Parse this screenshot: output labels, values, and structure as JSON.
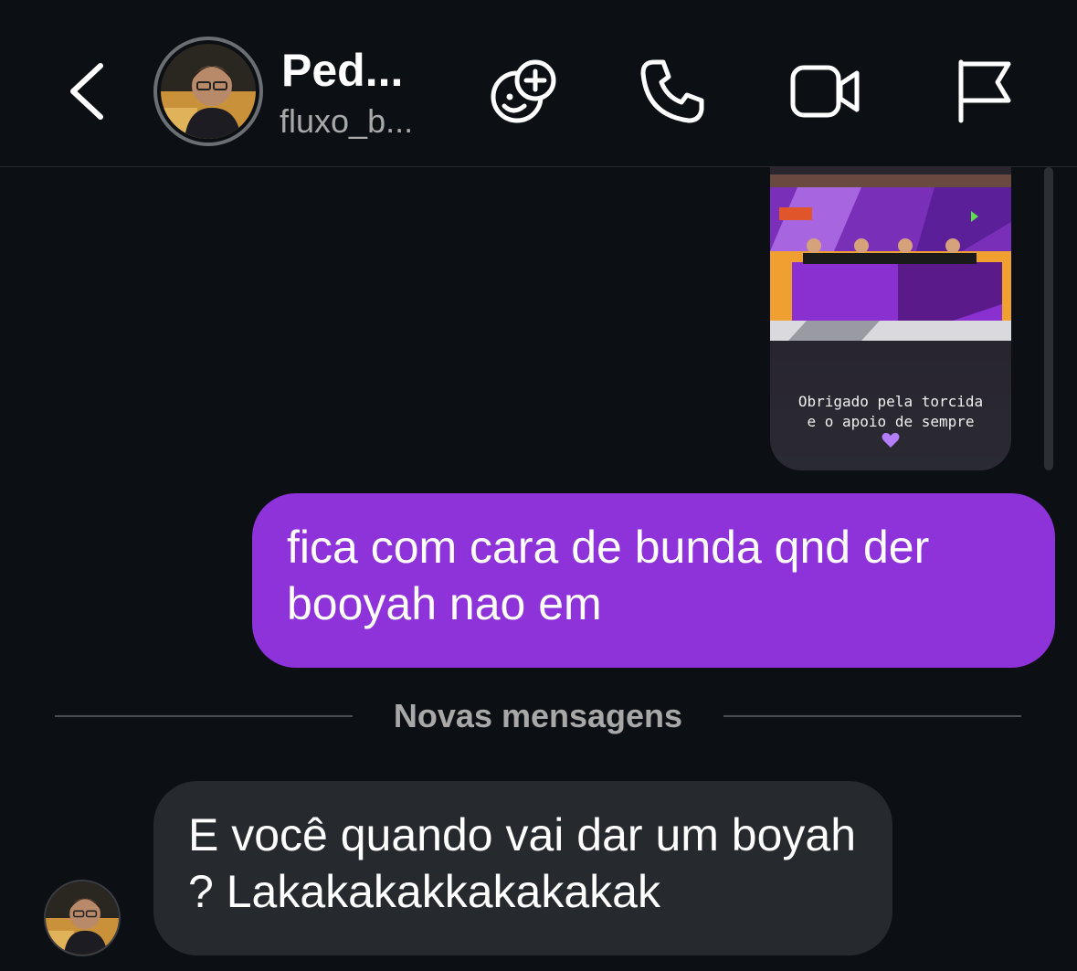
{
  "header": {
    "name": "Ped...",
    "username": "fluxo_b...",
    "icons": [
      "back-icon",
      "effects-icon",
      "phone-icon",
      "video-icon",
      "flag-icon"
    ]
  },
  "story": {
    "caption": "Obrigado pela torcida\ne o apoio de sempre",
    "heart_color": "#b47cff"
  },
  "messages": {
    "sent_text": "fica com cara de bunda qnd der booyah nao em",
    "divider_label": "Novas mensagens",
    "received_text": "E você quando vai dar um boyah ? Lakakakakkakakakak"
  },
  "colors": {
    "sent_bubble": "#8d33d9",
    "received_bubble": "#262a2f",
    "background": "#0c1014"
  }
}
